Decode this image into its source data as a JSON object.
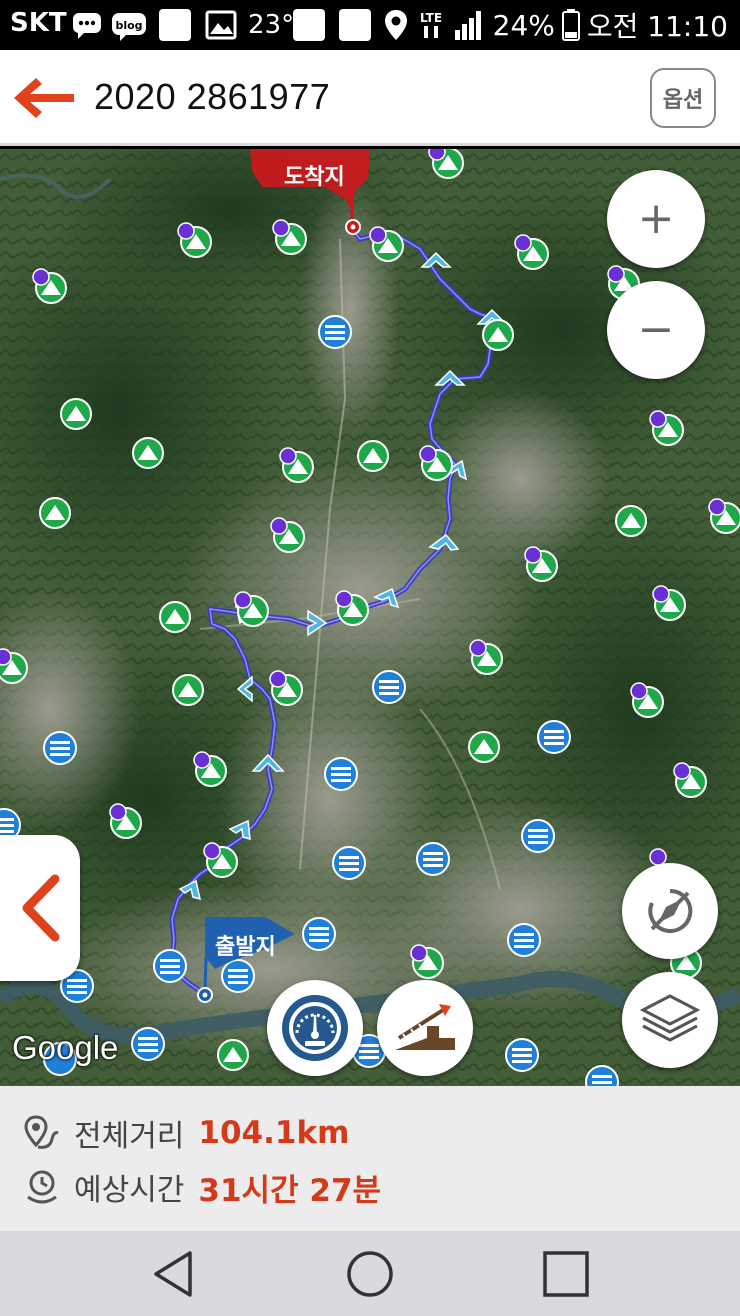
{
  "status_bar": {
    "carrier": "SKT",
    "temperature": "23°",
    "network": "LTE",
    "battery": "24%",
    "time": "오전 11:10"
  },
  "header": {
    "title": "2020 2861977",
    "option_label": "옵션"
  },
  "map": {
    "destination_label": "도착지",
    "origin_label": "출발지",
    "attribution": "Google",
    "zoom_in": "+",
    "zoom_out": "−",
    "route_color": "#3f3fc8",
    "flag_color": "#c8191e",
    "start_flag_color": "#1b5fb5"
  },
  "summary": {
    "distance_label": "전체거리",
    "distance_value": "104.1km",
    "time_label": "예상시간",
    "time_value": "31시간 27분",
    "accent_color": "#d43a1a"
  },
  "nav": {
    "back": "back-triangle-icon",
    "home": "home-circle-icon",
    "recents": "recents-square-icon"
  }
}
